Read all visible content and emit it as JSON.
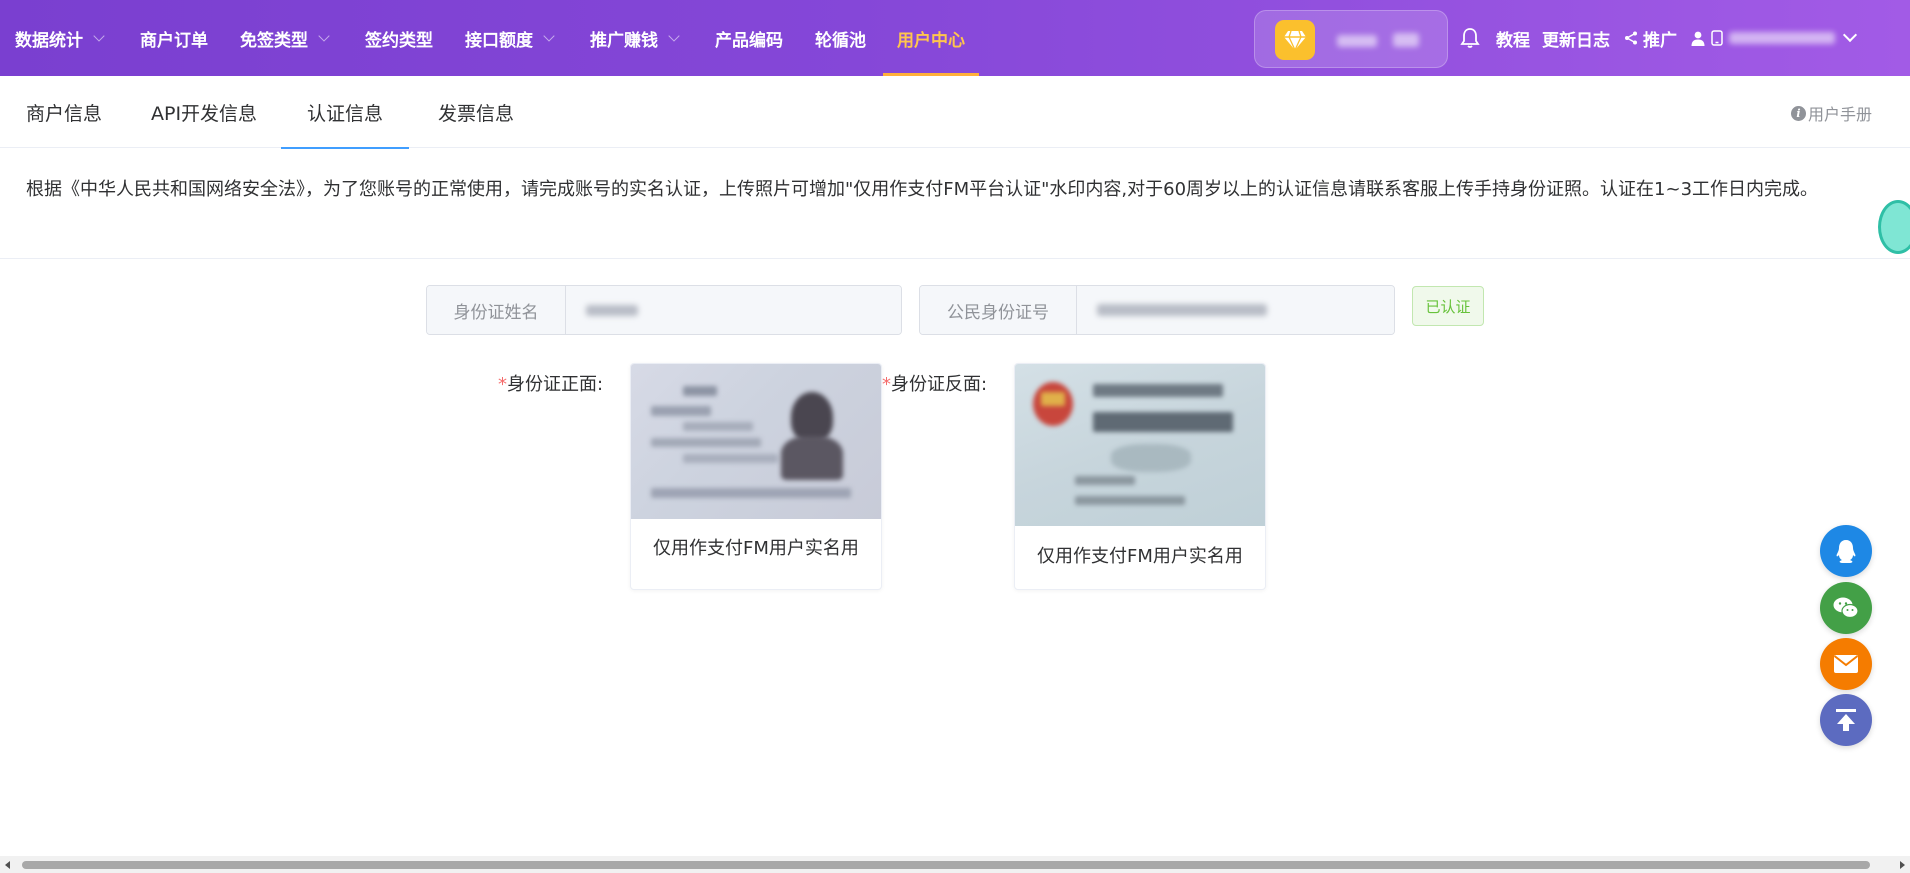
{
  "nav": {
    "items": [
      {
        "label": "数据统计",
        "dropdown": true
      },
      {
        "label": "商户订单",
        "dropdown": false
      },
      {
        "label": "免签类型",
        "dropdown": true
      },
      {
        "label": "签约类型",
        "dropdown": false
      },
      {
        "label": "接口额度",
        "dropdown": true
      },
      {
        "label": "推广赚钱",
        "dropdown": true
      },
      {
        "label": "产品编码",
        "dropdown": false
      },
      {
        "label": "轮循池",
        "dropdown": false
      },
      {
        "label": "用户中心",
        "dropdown": false,
        "active": true
      }
    ],
    "tutorial": "教程",
    "changelog": "更新日志",
    "promote": "推广",
    "active_color": "#ffc54d"
  },
  "tabs": [
    {
      "label": "商户信息"
    },
    {
      "label": "API开发信息"
    },
    {
      "label": "认证信息",
      "active": true
    },
    {
      "label": "发票信息"
    }
  ],
  "manual_link": "用户手册",
  "notice": "根据《中华人民共和国网络安全法》，为了您账号的正常使用，请完成账号的实名认证，上传照片可增加\"仅用作支付FM平台认证\"水印内容,对于60周岁以上的认证信息请联系客服上传手持身份证照。认证在1~3工作日内完成。",
  "form": {
    "name_label": "身份证姓名",
    "id_label": "公民身份证号",
    "status": "已认证"
  },
  "cards": {
    "front_label": "身份证正面:",
    "back_label": "身份证反面:",
    "front_caption": "仅用作支付FM用户实名用",
    "back_caption": "仅用作支付FM用户实名用",
    "required_mark": "*"
  },
  "colors": {
    "nav_gradient_start": "#7a3fd0",
    "nav_gradient_end": "#a25be6",
    "tab_active": "#409eff",
    "qq": "#1e88e5",
    "wechat": "#43a047",
    "email": "#f57c00",
    "top": "#5c6bc0"
  }
}
